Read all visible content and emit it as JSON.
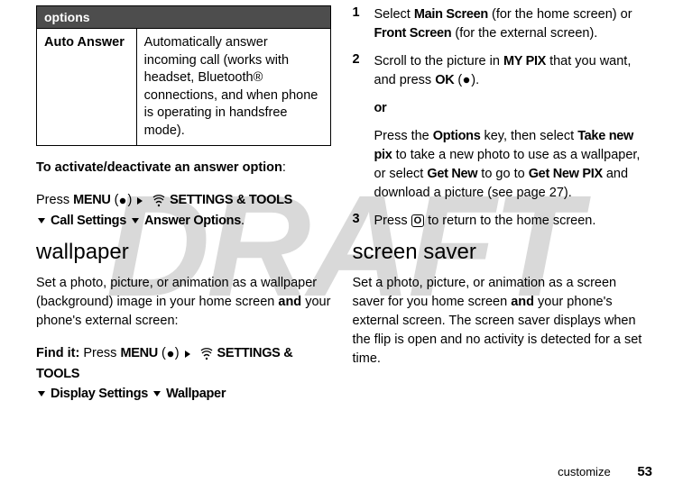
{
  "watermark": "DRAFT",
  "left": {
    "table": {
      "header": "options",
      "row_label": "Auto Answer",
      "row_desc": "Automatically answer incoming call (works with headset, Bluetooth® connections, and when phone is operating in handsfree mode)."
    },
    "activate_line": "To activate/deactivate an answer option",
    "press_label": "Press ",
    "menu_bold": "MENU",
    "menu_paren": " (",
    "menu_paren_close": ") ",
    "settings_tools": " SETTINGS & TOOLS",
    "call_settings": "Call Settings",
    "answer_options": "Answer Options",
    "wallpaper_heading": "wallpaper",
    "wallpaper_intro_a": "Set a photo, picture, or animation as a wallpaper (background) image in your home screen ",
    "wallpaper_intro_and": "and",
    "wallpaper_intro_b": " your phone's external screen:",
    "findit_label": "Find it: ",
    "findit_press": "Press ",
    "display_settings": "Display Settings",
    "wallpaper_item": "Wallpaper"
  },
  "right": {
    "step1_a": "Select ",
    "step1_main": "Main Screen",
    "step1_b": " (for the home screen) or ",
    "step1_front": "Front Screen",
    "step1_c": " (for the external screen).",
    "step2_a": "Scroll to the picture in ",
    "step2_mypix": "MY PIX",
    "step2_b": " that you want, and press ",
    "step2_ok": "OK",
    "step2_c": " (",
    "step2_d": ").",
    "or_label": "or",
    "step2_sub_a": "Press the ",
    "step2_options": "Options",
    "step2_sub_b": " key, then select ",
    "step2_take": "Take new pix",
    "step2_sub_c": " to take a new photo to use as a wallpaper, or select ",
    "step2_getnew": "Get New",
    "step2_sub_d": " to go to ",
    "step2_getnewpix": "Get New PIX",
    "step2_sub_e": " and download a picture (see page 27).",
    "step3_a": "Press ",
    "step3_key": "O",
    "step3_b": " to return to the home screen.",
    "saver_heading": "screen saver",
    "saver_intro_a": "Set a photo, picture, or animation as a screen saver for you home screen ",
    "saver_and": "and",
    "saver_intro_b": " your phone's external screen. The screen saver displays when the flip is open and no activity is detected for a set time."
  },
  "footer": {
    "section": "customize",
    "page": "53"
  }
}
